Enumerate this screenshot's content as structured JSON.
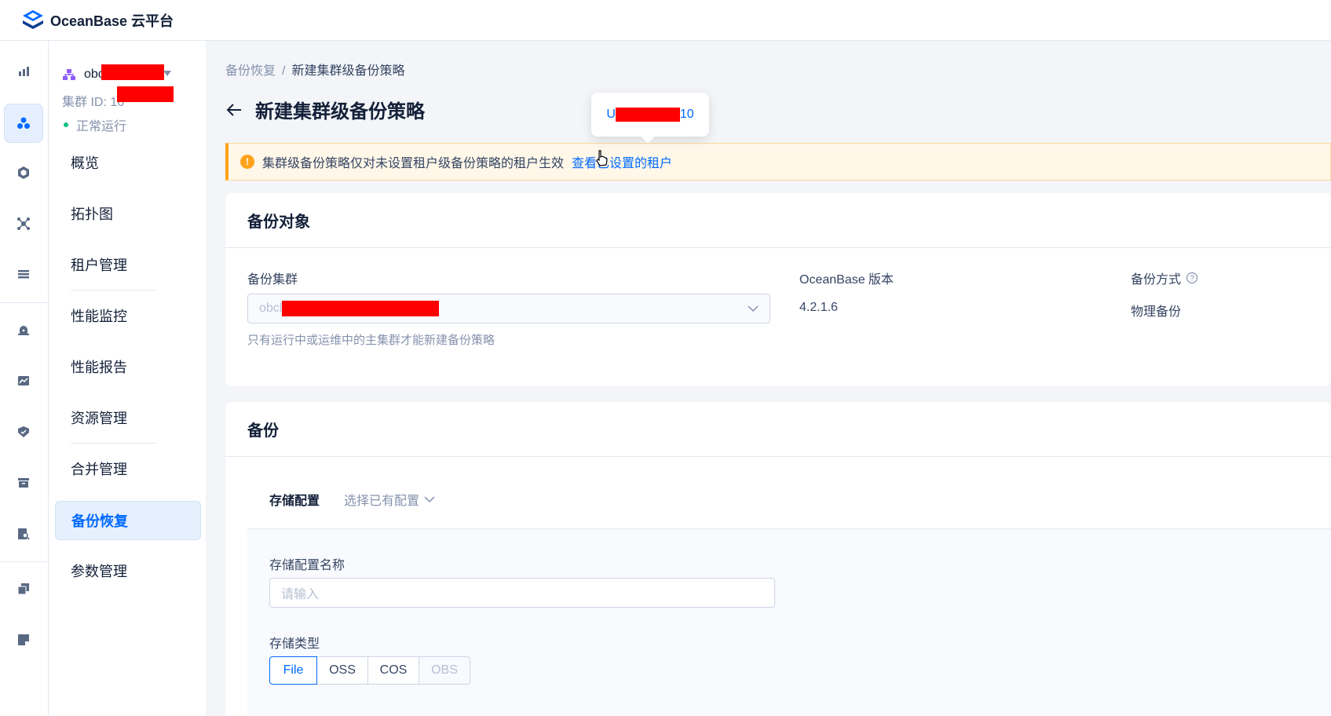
{
  "app": {
    "brand": "OceanBase 云平台"
  },
  "colors": {
    "accent": "#006aff",
    "warning": "#ffa31a",
    "success": "#0ac185"
  },
  "rail": {
    "icons": [
      "bar-chart-icon",
      "cluster-icon",
      "hexagon-icon",
      "topology-icon",
      "list-icon",
      "alarm-icon",
      "monitor-icon",
      "shield-icon",
      "package-icon",
      "search-doc-icon",
      "copy-icon",
      "note-icon"
    ]
  },
  "cluster": {
    "name": "obcl",
    "id_label": "集群 ID: 16",
    "status": "正常运行"
  },
  "nav": {
    "items": [
      {
        "label": "概览"
      },
      {
        "label": "拓扑图"
      },
      {
        "label": "租户管理"
      },
      {
        "label": "性能监控"
      },
      {
        "label": "性能报告"
      },
      {
        "label": "资源管理"
      },
      {
        "label": "合并管理"
      },
      {
        "label": "备份恢复"
      },
      {
        "label": "参数管理"
      }
    ],
    "active": "备份恢复"
  },
  "breadcrumb": {
    "parent": "备份恢复",
    "separator": "/",
    "current": "新建集群级备份策略"
  },
  "page": {
    "title": "新建集群级备份策略"
  },
  "tooltip": {
    "text_start": "U",
    "text_end": "10"
  },
  "alert": {
    "message": "集群级备份策略仅对未设置租户级备份策略的租户生效",
    "link": "查看已设置的租户"
  },
  "backup_object": {
    "title": "备份对象",
    "cluster_label": "备份集群",
    "cluster_value": "obcl",
    "cluster_help": "只有运行中或运维中的主集群才能新建备份策略",
    "version_label": "OceanBase 版本",
    "version_value": "4.2.1.6",
    "mode_label": "备份方式",
    "mode_value": "物理备份"
  },
  "backup": {
    "title": "备份",
    "storage_tab": "存储配置",
    "select_existing": "选择已有配置",
    "config_name_label": "存储配置名称",
    "config_name_placeholder": "请输入",
    "storage_type_label": "存储类型",
    "storage_types": [
      "File",
      "OSS",
      "COS",
      "OBS"
    ],
    "selected_type": "File"
  }
}
